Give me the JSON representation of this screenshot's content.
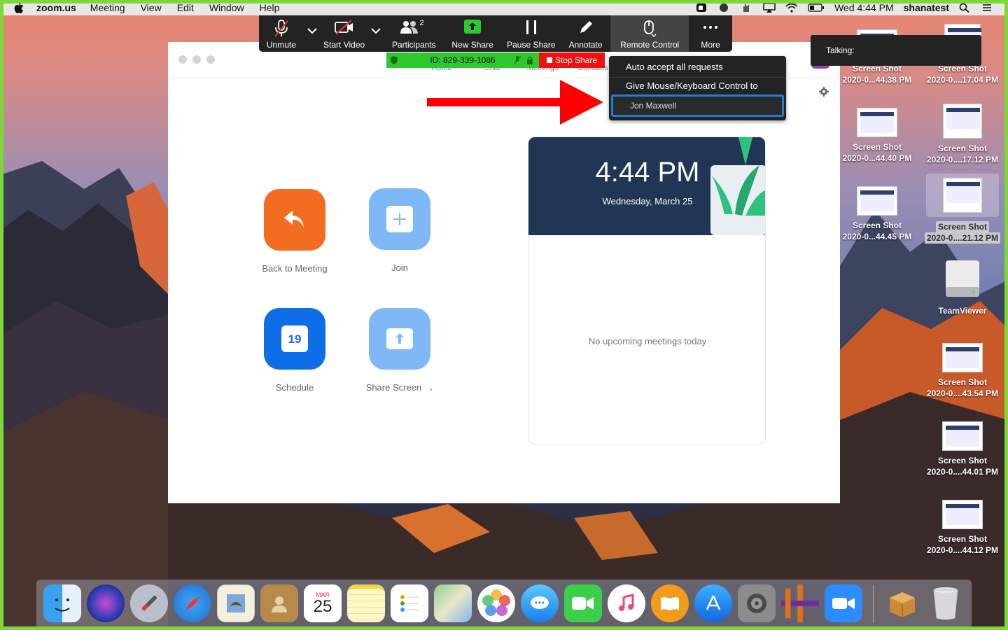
{
  "menubar": {
    "app_name": "zoom.us",
    "items": [
      "Meeting",
      "View",
      "Edit",
      "Window",
      "Help"
    ],
    "clock": "Wed 4:44 PM",
    "user": "shanatest"
  },
  "toolbar": {
    "buttons": [
      {
        "label": "Unmute",
        "icon": "mic-muted-icon"
      },
      {
        "label": "Start Video",
        "icon": "video-off-icon"
      },
      {
        "label": "Participants",
        "icon": "participants-icon",
        "count": "2"
      },
      {
        "label": "New Share",
        "icon": "share-up-icon"
      },
      {
        "label": "Pause Share",
        "icon": "pause-icon"
      },
      {
        "label": "Annotate",
        "icon": "pencil-icon"
      },
      {
        "label": "Remote Control",
        "icon": "mouse-icon"
      },
      {
        "label": "More",
        "icon": "ellipsis-icon"
      }
    ]
  },
  "status": {
    "meeting_id": "ID: 829-339-1086",
    "stop_share": "Stop Share"
  },
  "dropdown": {
    "auto_accept": "Auto accept all requests",
    "give_control": "Give Mouse/Keyboard Control to",
    "participant": "Jon Maxwell"
  },
  "talking": {
    "label": "Talking:"
  },
  "zoom_window": {
    "tabs": [
      "Home",
      "Chat",
      "Meetings",
      "Contacts"
    ],
    "tiles": {
      "back_to_meeting": "Back to Meeting",
      "join": "Join",
      "schedule": "Schedule",
      "schedule_day": "19",
      "share_screen": "Share Screen"
    },
    "clock": {
      "time": "4:44 PM",
      "date": "Wednesday, March 25"
    },
    "no_meetings": "No upcoming meetings today"
  },
  "desktop": {
    "icons": [
      {
        "l1": "Screen Shot",
        "l2": "2020-0...44.38 PM"
      },
      {
        "l1": "Screen Shot",
        "l2": "2020-0....17.04 PM"
      },
      {
        "l1": "Screen Shot",
        "l2": "2020-0...44.40 PM"
      },
      {
        "l1": "Screen Shot",
        "l2": "2020-0....17.12 PM"
      },
      {
        "l1": "Screen Shot",
        "l2": "2020-0...44.45 PM"
      },
      {
        "l1": "Screen Shot",
        "l2": "2020-0....21.12 PM"
      },
      {
        "l1": "TeamViewer",
        "l2": ""
      },
      {
        "l1": "Screen Shot",
        "l2": "2020-0....43.54 PM"
      },
      {
        "l1": "Screen Shot",
        "l2": "2020-0....44.01 PM"
      },
      {
        "l1": "Screen Shot",
        "l2": "2020-0....44.12 PM"
      }
    ]
  },
  "dock": {
    "calendar_month": "MAR",
    "calendar_day": "25",
    "apps": [
      "finder-icon",
      "siri-icon",
      "launchpad-icon",
      "safari-icon",
      "mail-icon",
      "contacts-icon",
      "calendar-icon",
      "notes-icon",
      "reminders-icon",
      "maps-icon",
      "photos-icon",
      "messages-icon",
      "facetime-icon",
      "itunes-icon",
      "ibooks-icon",
      "app-store-icon",
      "system-preferences-icon",
      "app-icon",
      "zoom-icon",
      "installer-icon",
      "trash-icon"
    ]
  },
  "colors": {
    "accent": "#2d8cff",
    "toolbar_bg": "#232323",
    "share_green": "#2fc92f",
    "stop_red": "#e11111",
    "frame_green": "#7dd63a",
    "arrow_red": "#ff0000"
  }
}
